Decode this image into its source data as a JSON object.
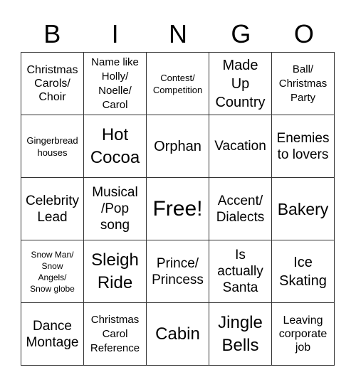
{
  "header": {
    "letters": [
      "B",
      "I",
      "N",
      "G",
      "O"
    ]
  },
  "cells": [
    "Christmas\nCarols/\nChoir",
    "Name like\nHolly/\nNoelle/\nCarol",
    "Contest/\nCompetition",
    "Made\nUp\nCountry",
    "Ball/\nChristmas\nParty",
    "Gingerbread\nhouses",
    "Hot\nCocoa",
    "Orphan",
    "Vacation",
    "Enemies\nto lovers",
    "Celebrity\nLead",
    "Musical\n/Pop\nsong",
    "Free!",
    "Accent/\nDialects",
    "Bakery",
    "Snow Man/\nSnow\nAngels/\nSnow globe",
    "Sleigh\nRide",
    "Prince/\nPrincess",
    "Is\nactually\nSanta",
    "Ice\nSkating",
    "Dance\nMontage",
    "Christmas\nCarol\nReference",
    "Cabin",
    "Jingle\nBells",
    "Leaving\ncorporate\njob"
  ]
}
